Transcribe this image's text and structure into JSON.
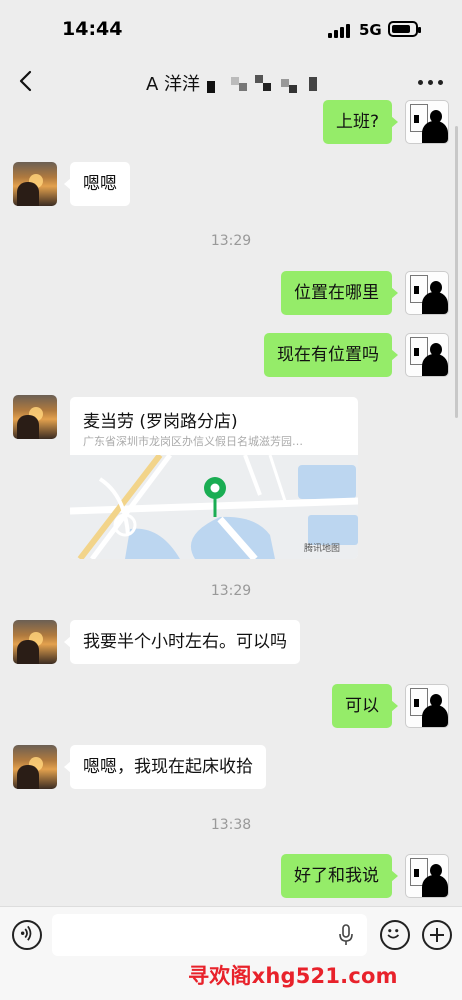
{
  "status_bar": {
    "time": "14:44",
    "network": "5G"
  },
  "nav": {
    "title": "A 洋洋",
    "back_icon": "chevron-left-icon",
    "more_icon": "ellipsis-icon"
  },
  "messages": {
    "m1": "上班?",
    "m2": "嗯嗯",
    "ts1": "13:29",
    "m3": "位置在哪里",
    "m4": "现在有位置吗",
    "ts2": "13:29",
    "m5": "我要半个小时左右。可以吗",
    "m6": "可以",
    "m7": "嗯嗯，我现在起床收拾",
    "ts3": "13:38",
    "m8": "好了和我说"
  },
  "location_card": {
    "name": "麦当劳 (罗岗路分店)",
    "address": "广东省深圳市龙岗区办信义假日名城滋芳园…",
    "map_brand": "腾讯地图"
  },
  "input_bar": {
    "voice_icon": "voice-icon",
    "emoji_icon": "emoji-icon",
    "plus_icon": "plus-icon",
    "mic_icon": "mic-icon"
  },
  "watermark": "寻欢阁xhg521.com",
  "colors": {
    "sent_bubble": "#95ec69",
    "received_bubble": "#ffffff",
    "background": "#ededed",
    "map_pin": "#1aad53",
    "watermark": "#e8222b"
  }
}
